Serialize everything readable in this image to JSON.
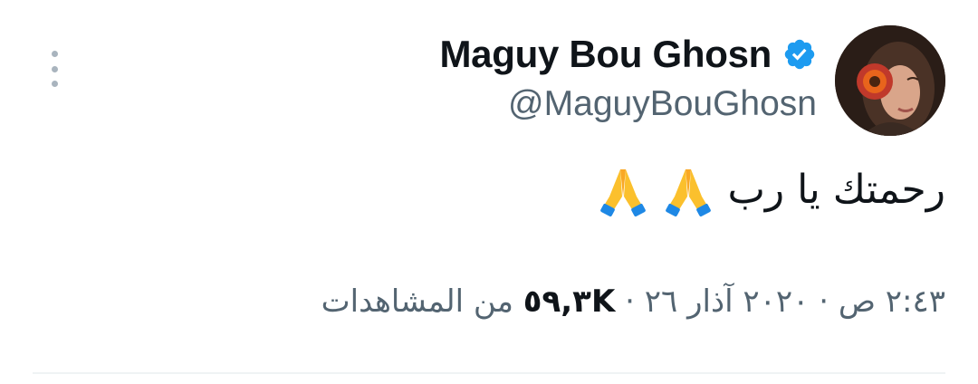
{
  "tweet": {
    "author": {
      "display_name": "Maguy Bou Ghosn",
      "handle": "@MaguyBouGhosn",
      "verified": true
    },
    "text": "رحمتك يا رب",
    "emoji": [
      "folded-hands",
      "folded-hands"
    ],
    "time": "٢:٤٣ ص",
    "date": "٢٠٢٠ آذار ٢٦",
    "separator": "·",
    "views_count": "٥٩,٣K",
    "views_label": "من المشاهدات"
  },
  "colors": {
    "verified_blue": "#1d9bf0",
    "text_primary": "#0f1419",
    "text_secondary": "#536471",
    "divider": "#eff3f4"
  },
  "icons": [
    "more-vertical-icon",
    "verified-badge-icon",
    "folded-hands-emoji-icon"
  ]
}
